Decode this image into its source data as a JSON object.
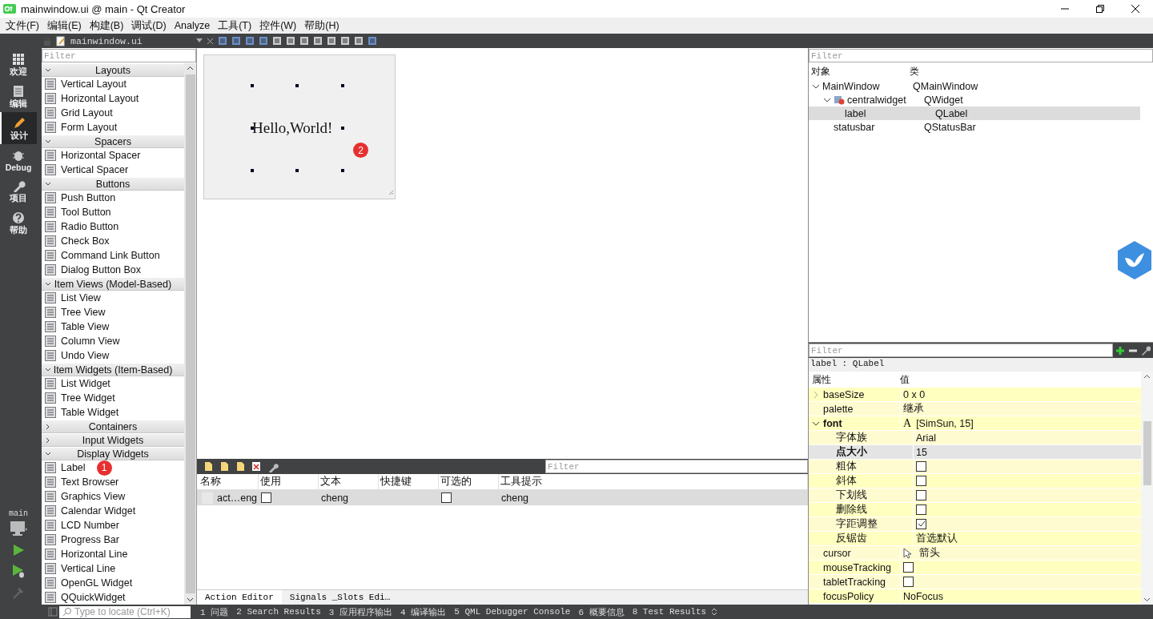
{
  "window": {
    "title": "mainwindow.ui @ main - Qt Creator"
  },
  "menu": [
    "文件(F)",
    "编辑(E)",
    "构建(B)",
    "调试(D)",
    "Analyze",
    "工具(T)",
    "控件(W)",
    "帮助(H)"
  ],
  "editor_tab": {
    "file": "mainwindow.ui"
  },
  "mode_bar": {
    "modes": [
      {
        "label": "欢迎",
        "selected": false
      },
      {
        "label": "编辑",
        "selected": false
      },
      {
        "label": "设计",
        "selected": true
      },
      {
        "label": "Debug",
        "selected": false
      },
      {
        "label": "项目",
        "selected": false
      },
      {
        "label": "帮助",
        "selected": false
      }
    ],
    "kit": "main"
  },
  "widget_box": {
    "filter_placeholder": "Filter",
    "categories": [
      {
        "name": "Layouts",
        "expanded": true,
        "items": [
          {
            "label": "Vertical Layout"
          },
          {
            "label": "Horizontal Layout"
          },
          {
            "label": "Grid Layout"
          },
          {
            "label": "Form Layout"
          }
        ]
      },
      {
        "name": "Spacers",
        "expanded": true,
        "items": [
          {
            "label": "Horizontal Spacer"
          },
          {
            "label": "Vertical Spacer"
          }
        ]
      },
      {
        "name": "Buttons",
        "expanded": true,
        "items": [
          {
            "label": "Push Button"
          },
          {
            "label": "Tool Button"
          },
          {
            "label": "Radio Button"
          },
          {
            "label": "Check Box"
          },
          {
            "label": "Command Link Button"
          },
          {
            "label": "Dialog Button Box"
          }
        ]
      },
      {
        "name": "Item Views (Model-Based)",
        "expanded": true,
        "items": [
          {
            "label": "List View"
          },
          {
            "label": "Tree View"
          },
          {
            "label": "Table View"
          },
          {
            "label": "Column View"
          },
          {
            "label": "Undo View"
          }
        ]
      },
      {
        "name": "Item Widgets (Item-Based)",
        "expanded": true,
        "items": [
          {
            "label": "List Widget"
          },
          {
            "label": "Tree Widget"
          },
          {
            "label": "Table Widget"
          }
        ]
      },
      {
        "name": "Containers",
        "expanded": false
      },
      {
        "name": "Input Widgets",
        "expanded": false
      },
      {
        "name": "Display Widgets",
        "expanded": true,
        "items": [
          {
            "label": "Label",
            "badge": "1"
          },
          {
            "label": "Text Browser"
          },
          {
            "label": "Graphics View"
          },
          {
            "label": "Calendar Widget"
          },
          {
            "label": "LCD Number"
          },
          {
            "label": "Progress Bar"
          },
          {
            "label": "Horizontal Line"
          },
          {
            "label": "Vertical Line"
          },
          {
            "label": "OpenGL Widget"
          },
          {
            "label": "QQuickWidget"
          }
        ]
      }
    ]
  },
  "form": {
    "label_text": "Hello,World!",
    "badge": "2"
  },
  "action_editor": {
    "filter_placeholder": "Filter",
    "columns": [
      "名称",
      "使用",
      "文本",
      "快捷键",
      "可选的",
      "工具提示"
    ],
    "rows": [
      {
        "name": "act…eng",
        "used": false,
        "text": "cheng",
        "checkable": false,
        "tooltip": "cheng",
        "selected": true
      }
    ],
    "tabs": [
      {
        "label": "Action Editor",
        "selected": true
      },
      {
        "label": "Signals _Slots Edi…",
        "selected": false
      }
    ]
  },
  "object_inspector": {
    "filter_placeholder": "Filter",
    "columns": [
      "对象",
      "类"
    ],
    "tree": [
      {
        "name": "MainWindow",
        "class": "QMainWindow",
        "expanded": true,
        "selected": false,
        "children": [
          {
            "name": "centralwidget",
            "class": "QWidget",
            "expanded": true,
            "selected": false,
            "children": [
              {
                "name": "label",
                "class": "QLabel",
                "selected": true
              }
            ]
          },
          {
            "name": "statusbar",
            "class": "QStatusBar",
            "selected": false
          }
        ]
      }
    ]
  },
  "property_editor": {
    "filter_placeholder": "Filter",
    "object": "label : QLabel",
    "columns": [
      "属性",
      "值"
    ],
    "rows": [
      {
        "name": "baseSize",
        "kind": "text",
        "value": "0 x 0",
        "expanded": false,
        "modified": false,
        "selected": false
      },
      {
        "name": "palette",
        "kind": "text",
        "value": "继承",
        "modified": false,
        "selected": false
      },
      {
        "name": "font",
        "kind": "font",
        "glyph": "A",
        "value": "[SimSun, 15]",
        "expanded": true,
        "modified": true,
        "selected": false,
        "children": [
          {
            "name": "字体族",
            "kind": "text",
            "value": "Arial",
            "modified": false,
            "selected": false
          },
          {
            "name": "点大小",
            "kind": "text",
            "value": "15",
            "modified": true,
            "selected": true
          },
          {
            "name": "粗体",
            "kind": "checkbox",
            "checked": false,
            "modified": false,
            "selected": false
          },
          {
            "name": "斜体",
            "kind": "checkbox",
            "checked": false,
            "modified": false,
            "selected": false
          },
          {
            "name": "下划线",
            "kind": "checkbox",
            "checked": false,
            "modified": false,
            "selected": false
          },
          {
            "name": "删除线",
            "kind": "checkbox",
            "checked": false,
            "modified": false,
            "selected": false
          },
          {
            "name": "字距调整",
            "kind": "checkbox",
            "checked": true,
            "modified": false,
            "selected": false
          },
          {
            "name": "反锯齿",
            "kind": "text",
            "value": "首选默认",
            "modified": false,
            "selected": false
          }
        ]
      },
      {
        "name": "cursor",
        "kind": "cursor",
        "value": "箭头",
        "modified": false,
        "selected": false
      },
      {
        "name": "mouseTracking",
        "kind": "checkbox",
        "checked": false,
        "modified": false,
        "selected": false
      },
      {
        "name": "tabletTracking",
        "kind": "checkbox",
        "checked": false,
        "modified": false,
        "selected": false
      },
      {
        "name": "focusPolicy",
        "kind": "text",
        "value": "NoFocus",
        "modified": false,
        "selected": false
      }
    ]
  },
  "output_bar": {
    "locate_placeholder": "Type to locate (Ctrl+K)",
    "panes": [
      "1 问题",
      "2 Search Results",
      "3 应用程序输出",
      "4 编译输出",
      "5 QML Debugger Console",
      "6 概要信息",
      "8 Test Results"
    ]
  }
}
